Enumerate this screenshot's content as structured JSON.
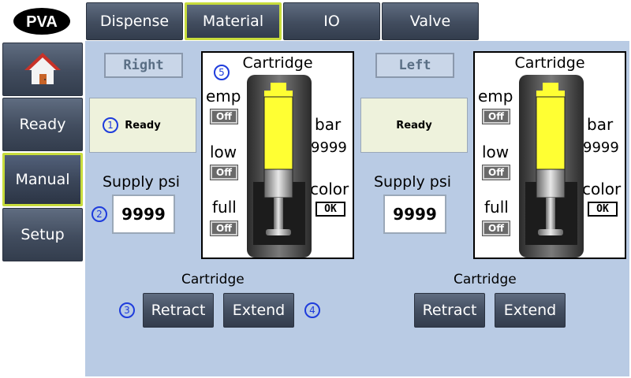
{
  "logo": {
    "text": "PVA"
  },
  "tabs": [
    {
      "label": "Dispense"
    },
    {
      "label": "Material"
    },
    {
      "label": "IO"
    },
    {
      "label": "Valve"
    }
  ],
  "sidebar": {
    "home_icon": "home-icon",
    "items": [
      {
        "label": "Ready"
      },
      {
        "label": "Manual"
      },
      {
        "label": "Setup"
      }
    ]
  },
  "right": {
    "side_label": "Right",
    "status": "Ready",
    "supply_label": "Supply psi",
    "supply_value": "9999",
    "cartridge_title": "Cartridge",
    "emp_label": "emp",
    "emp_state": "Off",
    "low_label": "low",
    "low_state": "Off",
    "full_label": "full",
    "full_state": "Off",
    "bar_label": "bar",
    "bar_value": "9999",
    "color_label": "color",
    "color_state": "OK",
    "cartridge_label": "Cartridge",
    "retract_label": "Retract",
    "extend_label": "Extend"
  },
  "left": {
    "side_label": "Left",
    "status": "Ready",
    "supply_label": "Supply psi",
    "supply_value": "9999",
    "cartridge_title": "Cartridge",
    "emp_label": "emp",
    "emp_state": "Off",
    "low_label": "low",
    "low_state": "Off",
    "full_label": "full",
    "full_state": "Off",
    "bar_label": "bar",
    "bar_value": "9999",
    "color_label": "color",
    "color_state": "OK",
    "cartridge_label": "Cartridge",
    "retract_label": "Retract",
    "extend_label": "Extend"
  },
  "callouts": [
    "1",
    "2",
    "3",
    "4",
    "5"
  ],
  "colors": {
    "panel_bg": "#b9cbe4",
    "accent": "#c8dc3c",
    "button": "#414c5e",
    "callout": "#1e3cdc",
    "fill": "#ffff33"
  }
}
